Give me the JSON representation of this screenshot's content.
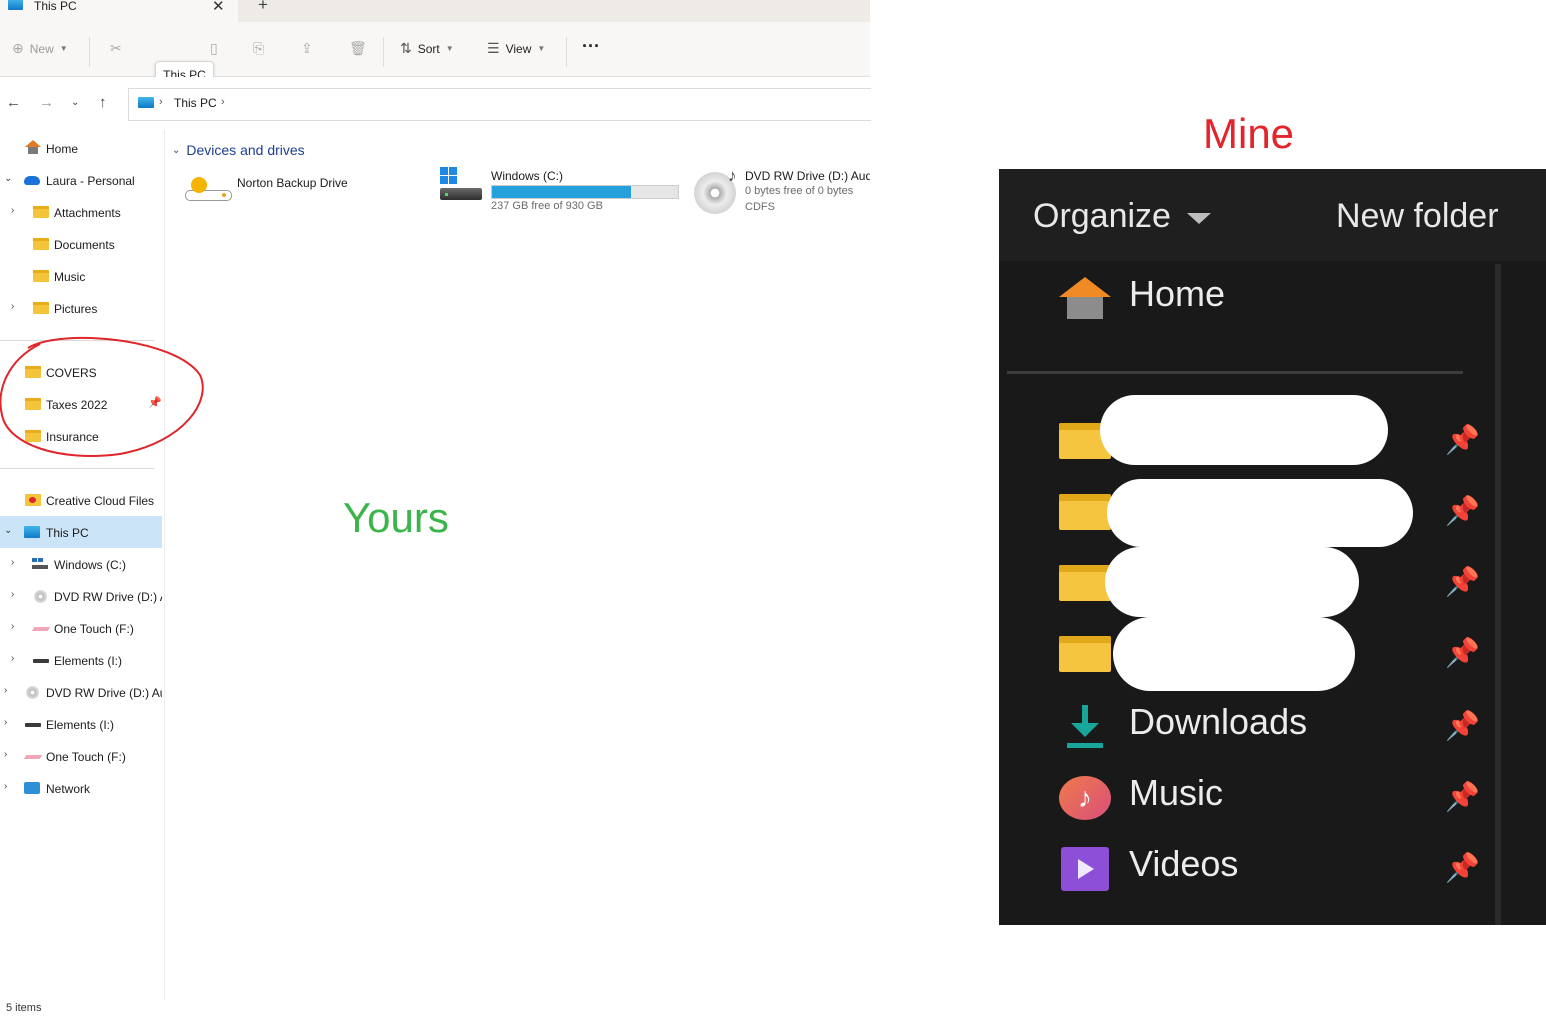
{
  "tab": {
    "title": "This PC"
  },
  "toolbar": {
    "new_label": "New",
    "sort_label": "Sort",
    "view_label": "View",
    "more_label": "···",
    "tooltip": "This PC"
  },
  "address": {
    "crumb": "This PC"
  },
  "nav": {
    "home": "Home",
    "onedrive": "Laura - Personal",
    "od_children": [
      "Attachments",
      "Documents",
      "Music",
      "Pictures"
    ],
    "pinned": [
      "COVERS",
      "Taxes 2022",
      "Insurance"
    ],
    "creative_cloud": "Creative Cloud Files",
    "this_pc": "This PC",
    "pc_children": [
      "Windows (C:)",
      "DVD RW Drive (D:) A",
      "One Touch (F:)",
      "Elements (I:)"
    ],
    "drives": [
      "DVD RW Drive (D:) Au",
      "Elements (I:)",
      "One Touch (F:)"
    ],
    "network": "Network"
  },
  "content": {
    "group_title": "Devices and drives",
    "drives": [
      {
        "name": "Norton Backup Drive"
      },
      {
        "name": "Windows (C:)",
        "free": "237 GB free of 930 GB",
        "used_fraction": 0.745
      },
      {
        "name": "DVD RW Drive (D:) Audi",
        "free": "0 bytes free of 0 bytes",
        "fs": "CDFS"
      }
    ]
  },
  "status": {
    "items": "5 items"
  },
  "annotation_yours": "Yours",
  "annotation_mine": "Mine",
  "dark_panel": {
    "organize": "Organize",
    "new_folder": "New folder",
    "home": "Home",
    "quick_access": [
      "Downloads",
      "Music",
      "Videos"
    ]
  }
}
